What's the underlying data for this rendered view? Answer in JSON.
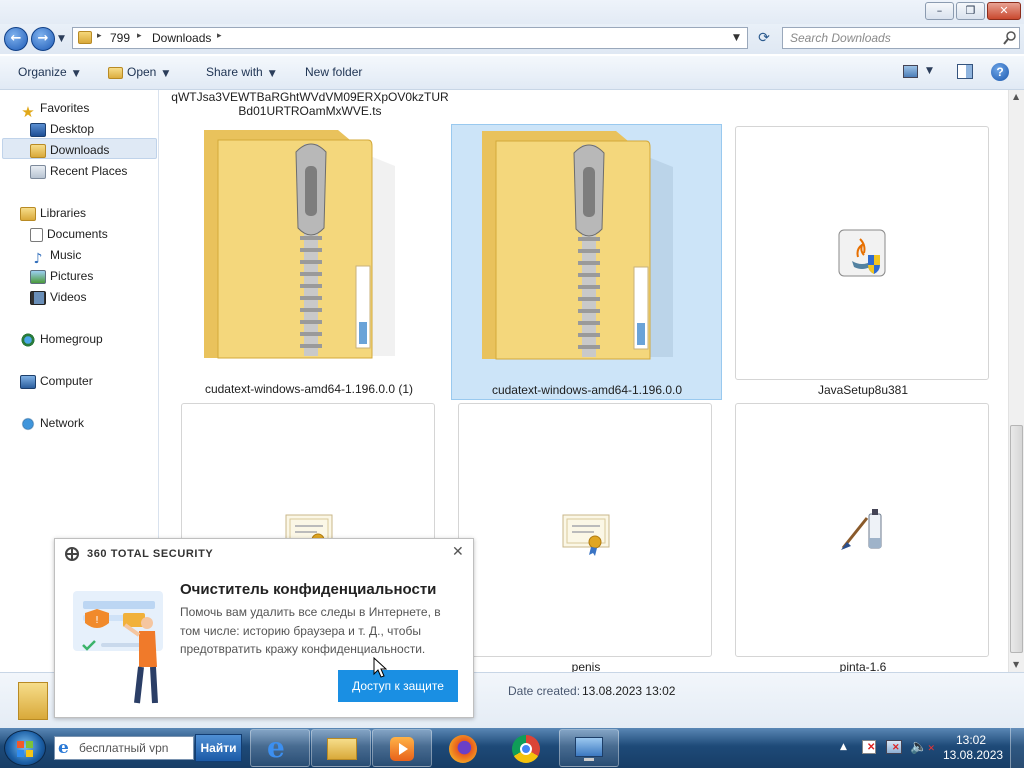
{
  "window": {
    "minimize_glyph": "–",
    "maximize_glyph": "❐",
    "close_glyph": "✕"
  },
  "address": {
    "back_glyph": "←",
    "forward_glyph": "→",
    "path": [
      "799",
      "Downloads"
    ],
    "separator": "▸",
    "search_placeholder": "Search Downloads"
  },
  "toolbar": {
    "organize_label": "Organize",
    "open_label": "Open",
    "share_label": "Share with",
    "new_folder_label": "New folder",
    "help_glyph": "?"
  },
  "sidebar": {
    "favorites": "Favorites",
    "favorites_items": [
      "Desktop",
      "Downloads",
      "Recent Places"
    ],
    "libraries": "Libraries",
    "libraries_items": [
      "Documents",
      "Music",
      "Pictures",
      "Videos"
    ],
    "homegroup": "Homegroup",
    "computer": "Computer",
    "network": "Network"
  },
  "files": {
    "top_partial_line1": "qWTJsa3VEWTBaRGhtWVdVM09ERXpOV0kzTUR",
    "top_partial_line2": "Bd01URTROamMxWVE.ts",
    "items": [
      {
        "name": "cudatext-windows-amd64-1.196.0.0 (1)",
        "icon": "zip-folder-icon",
        "selected": false
      },
      {
        "name": "cudatext-windows-amd64-1.196.0.0",
        "icon": "zip-folder-icon",
        "selected": true
      },
      {
        "name": "JavaSetup8u381",
        "icon": "java-installer-icon",
        "selected": false
      },
      {
        "name": "",
        "icon": "certificate-icon",
        "selected": false
      },
      {
        "name": "penis",
        "icon": "certificate-icon",
        "selected": false
      },
      {
        "name": "pinta-1.6",
        "icon": "paint-brush-icon",
        "selected": false
      }
    ]
  },
  "details": {
    "date_created_label": "Date created:",
    "date_created_value": "13.08.2023 13:02"
  },
  "popup": {
    "brand": "360 TOTAL SECURITY",
    "close_glyph": "✕",
    "title": "Очиститель конфиденциальности",
    "body": "Помочь вам удалить все следы в Интернете, в том числе: историю браузера и т. Д., чтобы предотвратить кражу конфиденциальности.",
    "button_label": "Доступ к защите"
  },
  "taskbar": {
    "search_value": "бесплатный vpn",
    "search_button": "Найти",
    "time": "13:02",
    "date": "13.08.2023"
  },
  "colors": {
    "selection_bg": "#cce4f8",
    "selection_border": "#99c9ef",
    "popup_button": "#1a8fe3",
    "taskbar": "#1e4a78"
  }
}
